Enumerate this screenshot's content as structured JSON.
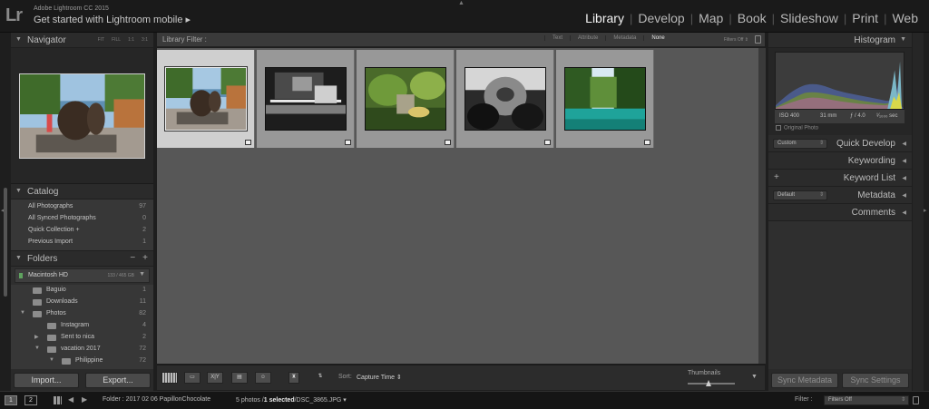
{
  "app": {
    "logo": "Lr",
    "title": "Adobe Lightroom CC 2015",
    "identity_plate": "Get started with Lightroom mobile ▸"
  },
  "modules": [
    "Library",
    "Develop",
    "Map",
    "Book",
    "Slideshow",
    "Print",
    "Web"
  ],
  "active_module": "Library",
  "left_panel": {
    "navigator": {
      "title": "Navigator",
      "zoom_options": [
        "FIT",
        "FILL",
        "1:1",
        "3:1"
      ]
    },
    "catalog": {
      "title": "Catalog",
      "items": [
        {
          "label": "All Photographs",
          "count": "97"
        },
        {
          "label": "All Synced Photographs",
          "count": "0"
        },
        {
          "label": "Quick Collection +",
          "count": "2"
        },
        {
          "label": "Previous Import",
          "count": "1"
        }
      ]
    },
    "folders": {
      "title": "Folders",
      "minus": "−",
      "plus": "+",
      "volume": {
        "name": "Macintosh HD",
        "size": "133 / 465 GB"
      },
      "items": [
        {
          "name": "Baguio",
          "count": "1",
          "indent": 0,
          "disclosure": ""
        },
        {
          "name": "Downloads",
          "count": "11",
          "indent": 0,
          "disclosure": ""
        },
        {
          "name": "Photos",
          "count": "82",
          "indent": 0,
          "disclosure": "▼"
        },
        {
          "name": "Instagram",
          "count": "4",
          "indent": 1,
          "disclosure": ""
        },
        {
          "name": "Sent to nica",
          "count": "2",
          "indent": 1,
          "disclosure": "▶"
        },
        {
          "name": "vacation 2017",
          "count": "72",
          "indent": 1,
          "disclosure": "▼"
        },
        {
          "name": "Philippine",
          "count": "72",
          "indent": 2,
          "disclosure": "▼"
        }
      ]
    },
    "import_label": "Import...",
    "export_label": "Export..."
  },
  "filter_bar": {
    "label": "Library Filter :",
    "tabs": [
      "Text",
      "Attribute",
      "Metadata",
      "None"
    ],
    "active_tab": "None",
    "filters_off": "Filters Off ⇕"
  },
  "grid": {
    "cells": [
      {
        "name": "photo-statues",
        "selected": true
      },
      {
        "name": "photo-candles-bw",
        "selected": false
      },
      {
        "name": "photo-garden",
        "selected": false
      },
      {
        "name": "photo-dog-bw",
        "selected": false
      },
      {
        "name": "photo-river-palms",
        "selected": false
      }
    ]
  },
  "toolbar": {
    "sort_label": "Sort:",
    "sort_value": "Capture Time ⇕",
    "thumbnails_label": "Thumbnails",
    "xy_label": "X|Y",
    "menu": "▼"
  },
  "right_panel": {
    "histogram": {
      "title": "Histogram",
      "iso": "ISO 400",
      "focal": "31 mm",
      "aperture": "ƒ / 4.0",
      "shutter": "¹⁄₁₀₀₀ sec",
      "original_photo": "Original Photo"
    },
    "quick_develop": {
      "title": "Quick Develop",
      "preset": "Custom"
    },
    "keywording": {
      "title": "Keywording"
    },
    "keyword_list": {
      "title": "Keyword List",
      "plus": "+"
    },
    "metadata": {
      "title": "Metadata",
      "preset": "Default"
    },
    "comments": {
      "title": "Comments"
    },
    "sync_metadata_label": "Sync Metadata",
    "sync_settings_label": "Sync Settings"
  },
  "filmstrip_bar": {
    "screen1": "1",
    "screen2": "2",
    "folder_text": "Folder : 2017 02 06 PapillonChocolate",
    "count_prefix": "5 photos /",
    "count_selected": "1 selected",
    "count_suffix": "/DSC_3865.JPG ▾",
    "filter_label": "Filter :",
    "filter_value": "Filters Off"
  },
  "colors": {
    "background": "#1e1e1e",
    "panel": "#2f2f2f",
    "grid_background": "#575757",
    "cell": "#989898",
    "cell_selected": "#cfcfcf",
    "active_text": "#f2f2f2"
  }
}
